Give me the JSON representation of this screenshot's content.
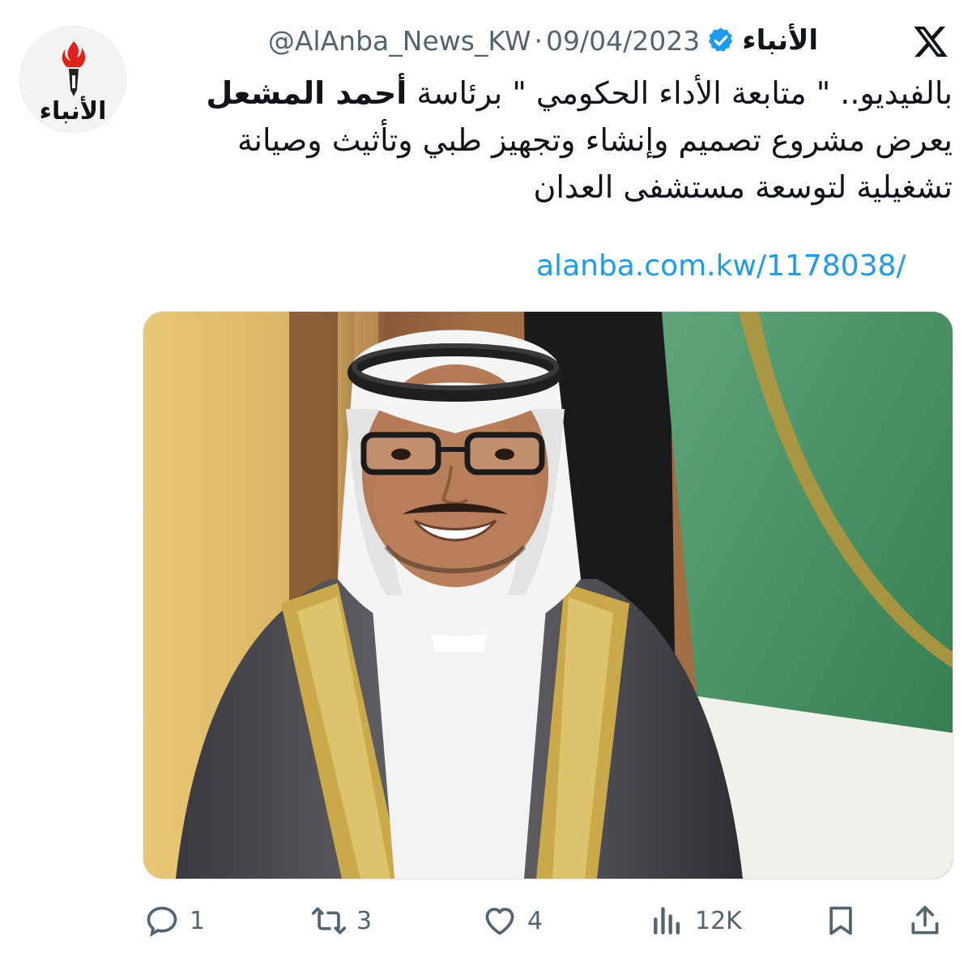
{
  "header": {
    "display_name": "الأنباء",
    "handle": "@AlAnba_News_KW",
    "separator": "·",
    "date": "09/04/2023",
    "avatar_wordmark": "الأنباء",
    "verified_color": "#1d9bf0"
  },
  "tweet": {
    "line1_part1": "بالفيديو.. \" متابعة الأداء الحكومي \" برئاسة ",
    "line1_bold": "أحمد المشعل",
    "line2": "يعرض مشروع تصميم وإنشاء وتجهيز طبي وتأثيث وصيانة",
    "line3": "تشغيلية لتوسعة مستشفى العدان",
    "link": "alanba.com.kw/1178038/"
  },
  "actions": {
    "replies": "1",
    "reposts": "3",
    "likes": "4",
    "views": "12K"
  },
  "icons": {
    "x": "x-logo-icon",
    "verified": "verified-badge-icon",
    "reply": "reply-icon",
    "repost": "repost-icon",
    "like": "heart-icon",
    "views": "views-chart-icon",
    "bookmark": "bookmark-icon",
    "share": "share-icon"
  },
  "colors": {
    "text": "#0f1419",
    "secondary": "#536471",
    "link": "#1d9bf0",
    "brand_red": "#e0231b"
  }
}
